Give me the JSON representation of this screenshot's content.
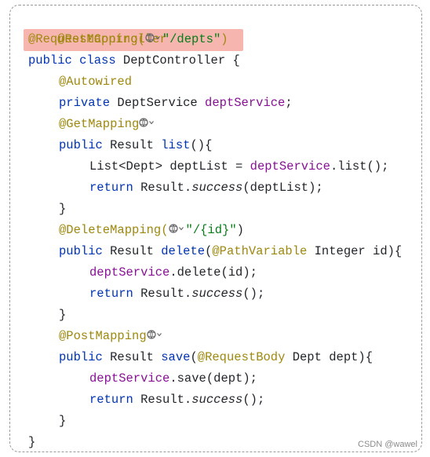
{
  "code": {
    "class_annotation": "@RestController",
    "mapping_annotation": "@RequestMapping(",
    "mapping_path": "\"/depts\"",
    "mapping_close": ")",
    "class_decl_kw": "public class ",
    "class_name": "DeptController {",
    "autowired": "@Autowired",
    "field_kw": "private ",
    "field_type": "DeptService ",
    "field_name": "deptService",
    "field_end": ";",
    "get_mapping": "@GetMapping",
    "list_sig_kw": "public ",
    "list_sig_type": "Result ",
    "list_name": "list",
    "list_sig_end": "(){",
    "list_body_1_pre": "List<Dept> deptList = ",
    "list_body_1_field": "deptService",
    "list_body_1_post": ".list();",
    "return_kw": "return ",
    "list_return_pre": "Result.",
    "success_method": "success",
    "list_return_post": "(deptList);",
    "close_brace": "}",
    "delete_mapping": "@DeleteMapping(",
    "delete_path": "\"/{id}\"",
    "delete_close": ")",
    "delete_sig_kw": "public ",
    "delete_sig_type": "Result ",
    "delete_name": "delete",
    "delete_open_paren": "(",
    "path_variable": "@PathVariable ",
    "delete_params": "Integer id){",
    "delete_body_field": "deptService",
    "delete_body_post": ".delete(id);",
    "success_empty_post": "();",
    "post_mapping": "@PostMapping",
    "save_sig_kw": "public ",
    "save_sig_type": "Result ",
    "save_name": "save",
    "save_open_paren": "(",
    "request_body": "@RequestBody ",
    "save_params": "Dept dept){",
    "save_body_field": "deptService",
    "save_body_post": ".save(dept);",
    "class_close": "}"
  },
  "icons": {
    "mapping_icon": "web-globe-icon",
    "dropdown_icon": "chevron-down-icon"
  },
  "watermark": "CSDN @wawel",
  "colors": {
    "annotation": "#9e880d",
    "keyword": "#0033b3",
    "field": "#871094",
    "string": "#067d17",
    "highlight": "#f7b5b0"
  }
}
